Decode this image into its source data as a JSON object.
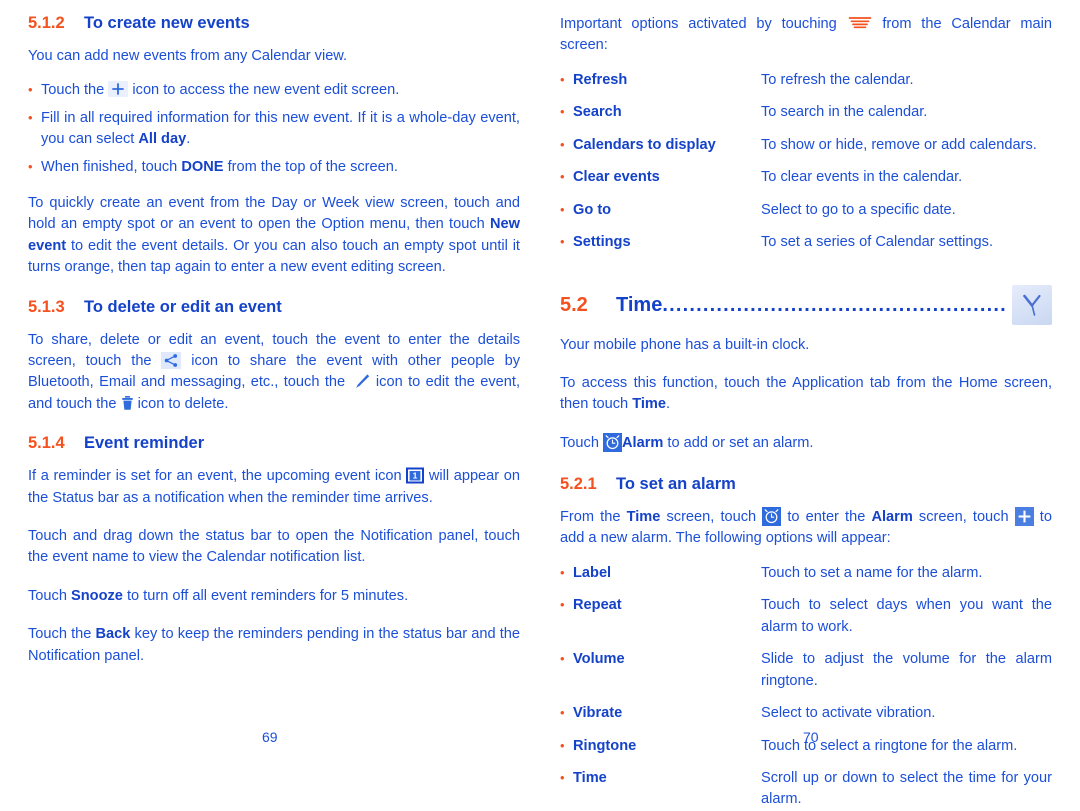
{
  "document": {
    "type": "user-manual-spread",
    "colors": {
      "heading_number": "#f4511e",
      "heading_title": "#1442c8",
      "body_text": "#1c4fd8",
      "bullet": "#f4511e",
      "icon_blue": "#2f6bdd"
    }
  },
  "left_page": {
    "page_number": "69",
    "section_512": {
      "number": "5.1.2",
      "title": "To create new events",
      "intro": "You can add new events from any Calendar view.",
      "bullets": [
        {
          "pre": "Touch the ",
          "icon": "plus-icon",
          "post": " icon to access the new event edit screen."
        },
        {
          "pre": "Fill in all required information for this new event. If it is a whole-day event, you can select ",
          "bold": "All day",
          "post": "."
        },
        {
          "pre": "When finished, touch ",
          "bold": "DONE",
          "post": " from the top of the screen."
        }
      ],
      "paragraph": {
        "part1": "To quickly create an event from the Day or Week view screen, touch and hold an empty spot or an event to open the Option menu, then touch ",
        "bold": "New event",
        "part2": " to edit the event details. Or you can also touch an empty spot until it turns orange, then tap again to enter a new event editing screen."
      }
    },
    "section_513": {
      "number": "5.1.3",
      "title": "To delete or edit an event",
      "paragraph": {
        "part1": "To share, delete or edit an event, touch the event to enter the details screen, touch the ",
        "icon1": "share-icon",
        "part2": " icon to share the event with other people by Bluetooth, Email and messaging, etc., touch the ",
        "icon2": "pencil-icon",
        "part3": " icon to edit the event, and touch the ",
        "icon3": "trash-icon",
        "part4": " icon to delete."
      }
    },
    "section_514": {
      "number": "5.1.4",
      "title": "Event reminder",
      "paragraph1": {
        "part1": "If a reminder is set for an event, the upcoming event icon ",
        "icon": "calendar-notification-icon",
        "part2": " will appear on the Status bar as a notification when the reminder time arrives."
      },
      "paragraph2": "Touch and drag down the status bar to open the Notification panel, touch the event name to view the Calendar notification list.",
      "paragraph3": {
        "part1": "Touch ",
        "bold": "Snooze",
        "part2": " to turn off all event reminders for 5 minutes."
      },
      "paragraph4": {
        "part1": "Touch the ",
        "bold": "Back",
        "part2": " key to keep the reminders pending in the status bar and the Notification panel."
      }
    }
  },
  "right_page": {
    "page_number": "70",
    "options_intro": {
      "part1": "Important options activated by touching ",
      "icon": "menu-icon",
      "part2": " from the Calendar main screen:"
    },
    "calendar_options": [
      {
        "term": "Refresh",
        "desc": "To refresh the calendar."
      },
      {
        "term": "Search",
        "desc": "To search in the calendar."
      },
      {
        "term": "Calendars to display",
        "desc": "To show or hide, remove or add calendars."
      },
      {
        "term": "Clear events",
        "desc": "To clear events in the calendar."
      },
      {
        "term": "Go to",
        "desc": "Select to go to a specific date."
      },
      {
        "term": "Settings",
        "desc": "To set a series of Calendar settings."
      }
    ],
    "section_52": {
      "number": "5.2",
      "title": "Time",
      "leader": "................................................................",
      "icon": "clock-hands-icon",
      "paragraph1": "Your mobile phone has a built-in clock.",
      "paragraph2": {
        "part1": "To access this function, touch the Application tab from the Home screen, then touch ",
        "bold": "Time",
        "part2": "."
      },
      "paragraph3": {
        "part1": "Touch ",
        "icon": "alarm-clock-icon",
        "bold": "Alarm",
        "part2": " to add or set an alarm."
      }
    },
    "section_521": {
      "number": "5.2.1",
      "title": "To set an alarm",
      "paragraph": {
        "part1": "From the ",
        "bold1": "Time",
        "part2": " screen, touch ",
        "icon1": "alarm-clock-icon",
        "part3": " to enter the ",
        "bold2": "Alarm",
        "part4": " screen, touch ",
        "icon2": "plus-box-icon",
        "part5": " to add a new alarm. The following options will appear:"
      },
      "alarm_options": [
        {
          "term": "Label",
          "desc": "Touch to set a name for the alarm."
        },
        {
          "term": "Repeat",
          "desc": "Touch to select days when you want the alarm to work."
        },
        {
          "term": "Volume",
          "desc": "Slide to adjust the volume for the alarm ringtone."
        },
        {
          "term": "Vibrate",
          "desc": "Select to activate vibration."
        },
        {
          "term": "Ringtone",
          "desc": "Touch to select a ringtone for the alarm."
        },
        {
          "term": "Time",
          "desc": "Scroll up or down to select the time for your alarm."
        }
      ]
    }
  }
}
